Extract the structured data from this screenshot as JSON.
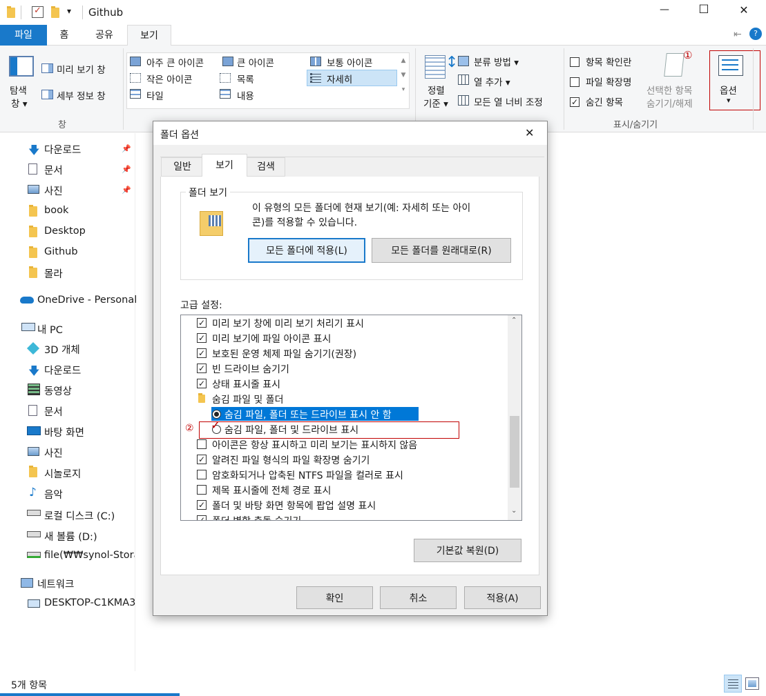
{
  "window": {
    "title": "Github",
    "minimize": "—",
    "maximize": "☐",
    "close": "✕"
  },
  "quick_access": {
    "dropdown": "▾"
  },
  "ribbon_tabs": [
    "파일",
    "홈",
    "공유",
    "보기"
  ],
  "ribbon": {
    "pane_group": {
      "nav_pane_line1": "탐색",
      "nav_pane_line2": "창 ▾",
      "preview_pane": "미리 보기 창",
      "details_pane": "세부 정보 창",
      "label": "창"
    },
    "layout": {
      "xl_icons": "아주 큰 아이콘",
      "l_icons": "큰 아이콘",
      "m_icons": "보통 아이콘",
      "s_icons": "작은 아이콘",
      "list": "목록",
      "details": "자세히",
      "tiles": "타일",
      "content": "내용"
    },
    "current_view": {
      "sort_line1": "정렬",
      "sort_line2": "기준 ▾",
      "group_by": "분류 방법 ▾",
      "add_columns": "열 추가 ▾",
      "fit_columns": "모든 열 너비 조정"
    },
    "show_hide": {
      "item_checkboxes": "항목 확인란",
      "file_ext": "파일 확장명",
      "hidden_items": "숨긴 항목",
      "hide_selected_line1": "선택한 항목",
      "hide_selected_line2": "숨기기/해제",
      "label": "표시/숨기기"
    },
    "options": {
      "label": "옵션",
      "arrow": "▾",
      "marker": "①"
    }
  },
  "sidebar": {
    "quick": [
      {
        "label": "다운로드",
        "icon": "download-icon"
      },
      {
        "label": "문서",
        "icon": "document-icon"
      },
      {
        "label": "사진",
        "icon": "pictures-icon"
      },
      {
        "label": "book",
        "icon": "folder-icon"
      },
      {
        "label": "Desktop",
        "icon": "folder-icon"
      },
      {
        "label": "Github",
        "icon": "folder-icon"
      },
      {
        "label": "몰라",
        "icon": "folder-icon"
      }
    ],
    "onedrive": "OneDrive - Personal",
    "pc": "내 PC",
    "pc_items": [
      {
        "label": "3D 개체",
        "icon": "3d-objects-icon"
      },
      {
        "label": "다운로드",
        "icon": "download-icon"
      },
      {
        "label": "동영상",
        "icon": "video-icon"
      },
      {
        "label": "문서",
        "icon": "document-icon"
      },
      {
        "label": "바탕 화면",
        "icon": "desktop-icon"
      },
      {
        "label": "사진",
        "icon": "pictures-icon"
      },
      {
        "label": "시놀로지",
        "icon": "folder-icon"
      },
      {
        "label": "음악",
        "icon": "music-icon"
      },
      {
        "label": "로컬 디스크 (C:)",
        "icon": "drive-icon"
      },
      {
        "label": "새 볼륨 (D:)",
        "icon": "drive-icon"
      },
      {
        "label": "file(₩₩synol-Storag",
        "icon": "network-drive-icon"
      }
    ],
    "network": "네트워크",
    "network_items": [
      {
        "label": "DESKTOP-C1KMA3",
        "icon": "computer-icon"
      }
    ]
  },
  "status_bar": {
    "count": "5개 항목"
  },
  "dialog": {
    "title": "폴더 옵션",
    "close": "✕",
    "tabs": [
      "일반",
      "보기",
      "검색"
    ],
    "folder_views": {
      "legend": "폴더 보기",
      "desc_line1": "이 유형의 모든 폴더에 현재 보기(예: 자세히 또는 아이",
      "desc_line2": "콘)를 적용할 수 있습니다.",
      "apply_all": "모든 폴더에 적용(L)",
      "reset_all": "모든 폴더를 원래대로(R)"
    },
    "advanced_label": "고급 설정:",
    "settings": [
      {
        "type": "check",
        "checked": true,
        "label": "미리 보기 창에 미리 보기 처리기 표시"
      },
      {
        "type": "check",
        "checked": true,
        "label": "미리 보기에 파일 아이콘 표시"
      },
      {
        "type": "check",
        "checked": true,
        "label": "보호된 운영 체제 파일 숨기기(권장)"
      },
      {
        "type": "check",
        "checked": true,
        "label": "빈 드라이브 숨기기"
      },
      {
        "type": "check",
        "checked": true,
        "label": "상태 표시줄 표시"
      },
      {
        "type": "folder",
        "label": "숨김 파일 및 폴더"
      },
      {
        "type": "radio",
        "checked": true,
        "selected": true,
        "label": "숨김 파일, 폴더 또는 드라이브 표시 안 함"
      },
      {
        "type": "radio",
        "checked": false,
        "label": "숨김 파일, 폴더 및 드라이브 표시",
        "marker": "②"
      },
      {
        "type": "check",
        "checked": false,
        "label": "아이콘은 항상 표시하고 미리 보기는 표시하지 않음"
      },
      {
        "type": "check",
        "checked": true,
        "label": "알려진 파일 형식의 파일 확장명 숨기기"
      },
      {
        "type": "check",
        "checked": false,
        "label": "암호화되거나 압축된 NTFS 파일을 컬러로 표시"
      },
      {
        "type": "check",
        "checked": false,
        "label": "제목 표시줄에 전체 경로 표시"
      },
      {
        "type": "check",
        "checked": true,
        "label": "폴더 및 바탕 화면 항목에 팝업 설명 표시"
      },
      {
        "type": "check",
        "checked": true,
        "label": "폴더 병합 충돌 숨기기"
      }
    ],
    "restore_defaults": "기본값 복원(D)",
    "ok": "확인",
    "cancel": "취소",
    "apply": "적용(A)"
  },
  "colors": {
    "accent": "#1979ca",
    "selection": "#0078d7",
    "annotation": "#c00000"
  }
}
